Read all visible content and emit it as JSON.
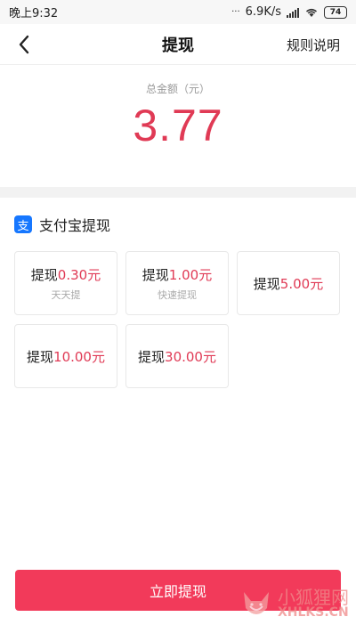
{
  "status_bar": {
    "time": "晚上9:32",
    "network_speed": "6.9K/s",
    "battery_level": "74"
  },
  "header": {
    "back_icon": "chevron-left-icon",
    "title": "提现",
    "rules_link": "规则说明"
  },
  "balance": {
    "label": "总金额（元）",
    "amount": "3.77",
    "amount_color": "#e03a55"
  },
  "withdraw_method": {
    "icon": "alipay-icon",
    "icon_glyph": "支",
    "icon_color": "#1677ff",
    "label": "支付宝提现"
  },
  "options": [
    {
      "prefix": "提现",
      "amount": "0.30元",
      "subtitle": "天天提"
    },
    {
      "prefix": "提现",
      "amount": "1.00元",
      "subtitle": "快速提现"
    },
    {
      "prefix": "提现",
      "amount": "5.00元",
      "subtitle": ""
    },
    {
      "prefix": "提现",
      "amount": "10.00元",
      "subtitle": ""
    },
    {
      "prefix": "提现",
      "amount": "30.00元",
      "subtitle": ""
    }
  ],
  "submit_button": {
    "label": "立即提现",
    "color": "#f23a5a"
  },
  "watermark": {
    "text_cn": "小狐狸网",
    "text_en": "XHLKS.CN"
  }
}
